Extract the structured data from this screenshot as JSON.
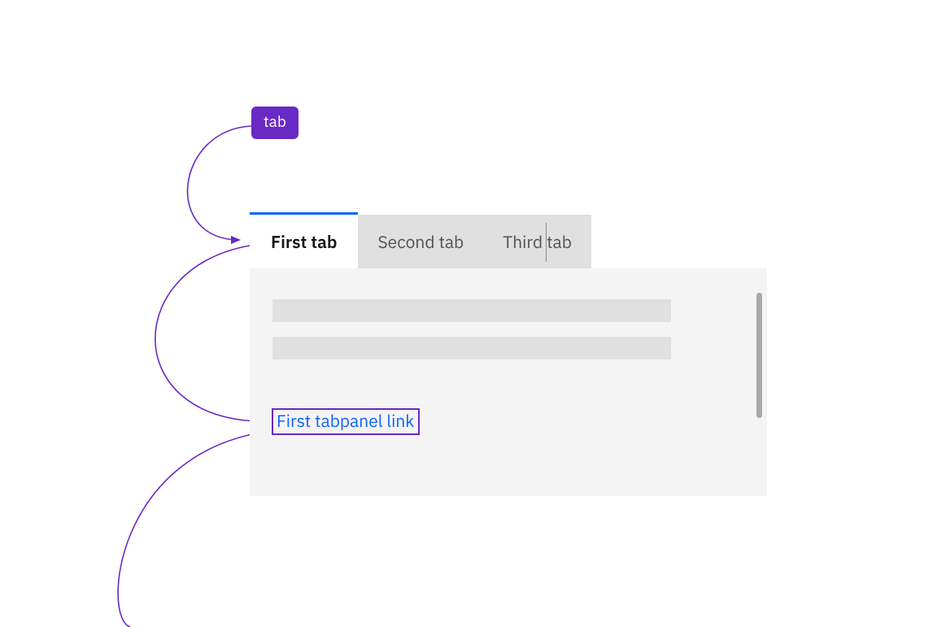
{
  "annotation": {
    "badge_label": "tab"
  },
  "tabs": {
    "items": [
      {
        "label": "First tab"
      },
      {
        "label": "Second tab"
      },
      {
        "label": "Third tab"
      }
    ]
  },
  "panel": {
    "link_text": "First tabpanel link"
  },
  "colors": {
    "accent_purple": "#6929c4",
    "accent_blue": "#0f62fe",
    "tab_inactive_bg": "#e0e0e0",
    "panel_bg": "#f4f4f4",
    "text_primary": "#161616",
    "text_secondary": "#525252",
    "scrollbar": "#a8a8a8"
  }
}
